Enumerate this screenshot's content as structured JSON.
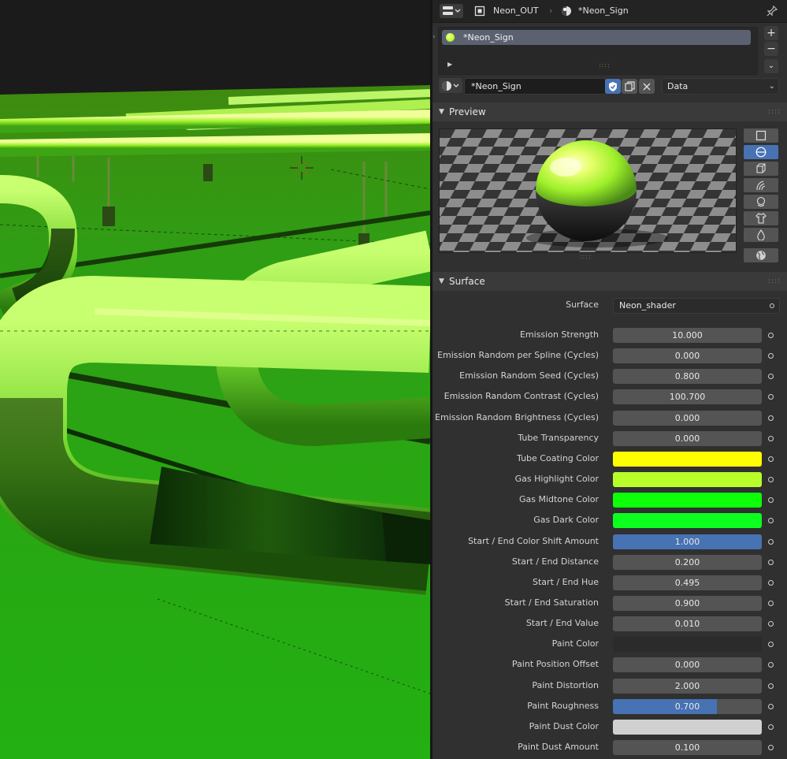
{
  "header": {
    "output_label": "Neon_OUT",
    "material_label": "*Neon_Sign"
  },
  "material_slots": {
    "items": [
      {
        "label": "*Neon_Sign"
      }
    ]
  },
  "material_selector": {
    "name": "*Neon_Sign",
    "link_mode": "Data"
  },
  "preview": {
    "title": "Preview"
  },
  "surface": {
    "title": "Surface",
    "shader_label": "Surface",
    "shader_value": "Neon_shader",
    "properties": [
      {
        "label": "Emission Strength",
        "type": "number",
        "value": "10.000"
      },
      {
        "label": "Emission Random per Spline (Cycles)",
        "type": "number",
        "value": "0.000"
      },
      {
        "label": "Emission Random Seed (Cycles)",
        "type": "number",
        "value": "0.800"
      },
      {
        "label": "Emission Random Contrast (Cycles)",
        "type": "number",
        "value": "100.700"
      },
      {
        "label": "Emission Random Brightness (Cycles)",
        "type": "number",
        "value": "0.000"
      },
      {
        "label": "Tube Transparency",
        "type": "number",
        "value": "0.000"
      },
      {
        "label": "Tube Coating Color",
        "type": "color",
        "color": "#ffff00"
      },
      {
        "label": "Gas Highlight Color",
        "type": "color",
        "color": "#b8ff2a"
      },
      {
        "label": "Gas Midtone Color",
        "type": "color",
        "color": "#0dff0a"
      },
      {
        "label": "Gas Dark Color",
        "type": "color",
        "color": "#0dff20"
      },
      {
        "label": "Start / End Color Shift Amount",
        "type": "factor",
        "value": "1.000",
        "fraction": 1.0
      },
      {
        "label": "Start / End Distance",
        "type": "number",
        "value": "0.200"
      },
      {
        "label": "Start / End Hue",
        "type": "number",
        "value": "0.495"
      },
      {
        "label": "Start / End Saturation",
        "type": "number",
        "value": "0.900"
      },
      {
        "label": "Start / End Value",
        "type": "number",
        "value": "0.010"
      },
      {
        "label": "Paint Color",
        "type": "color",
        "color": "#2b2b2b"
      },
      {
        "label": "Paint Position Offset",
        "type": "number",
        "value": "0.000"
      },
      {
        "label": "Paint Distortion",
        "type": "number",
        "value": "2.000"
      },
      {
        "label": "Paint Roughness",
        "type": "factor",
        "value": "0.700",
        "fraction": 0.7
      },
      {
        "label": "Paint Dust Color",
        "type": "color",
        "color": "#d0d0d0"
      },
      {
        "label": "Paint Dust Amount",
        "type": "number",
        "value": "0.100"
      }
    ]
  }
}
